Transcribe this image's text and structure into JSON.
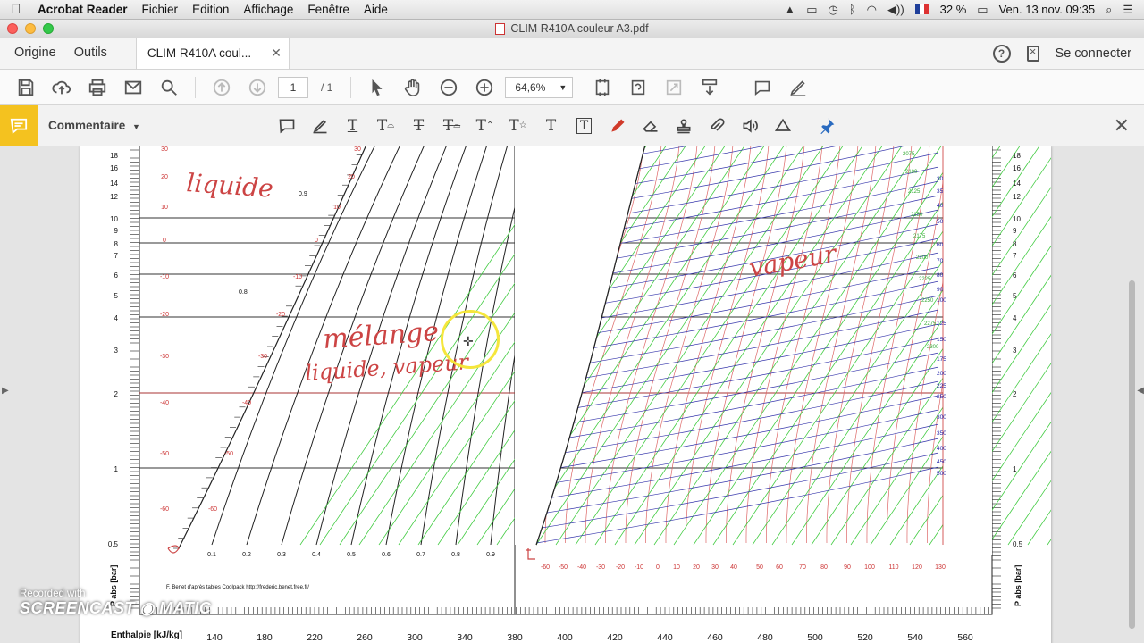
{
  "menubar": {
    "app_name": "Acrobat Reader",
    "menus": [
      "Fichier",
      "Edition",
      "Affichage",
      "Fenêtre",
      "Aide"
    ],
    "battery": "32 %",
    "datetime": "Ven. 13 nov.  09:35"
  },
  "window": {
    "title": "CLIM R410A couleur A3.pdf"
  },
  "tabs": {
    "home": "Origine",
    "tools": "Outils",
    "document": "CLIM R410A coul...",
    "sign_in": "Se connecter"
  },
  "toolbar": {
    "page_current": "1",
    "page_total": "/ 1",
    "zoom": "64,6%"
  },
  "comment_bar": {
    "label": "Commentaire"
  },
  "icons": {
    "save": "save-icon",
    "upload": "upload-icon",
    "print": "print-icon",
    "email": "email-icon",
    "search": "search-icon",
    "prev": "arrow-up-icon",
    "next": "arrow-down-icon",
    "select": "cursor-icon",
    "hand": "hand-icon",
    "zoom_out": "zoom-out-icon",
    "zoom_in": "zoom-in-icon"
  },
  "chart": {
    "pressure_ticks_left": [
      "18",
      "16",
      "14",
      "12",
      "10",
      "9",
      "8",
      "7",
      "6",
      "5",
      "4",
      "3",
      "2",
      "1",
      "0,5"
    ],
    "pressure_ticks_right": [
      "18",
      "16",
      "14",
      "12",
      "10",
      "9",
      "8",
      "7",
      "6",
      "5",
      "4",
      "3",
      "2",
      "1",
      "0,5"
    ],
    "enthalpy_ticks": [
      "140",
      "180",
      "220",
      "260",
      "300",
      "340",
      "380",
      "400",
      "420",
      "440",
      "460",
      "480",
      "500",
      "520",
      "540",
      "560"
    ],
    "enthalpy_axis_label": "Enthalpie [kJ/kg]",
    "pressure_axis_label": "P abs [bar]",
    "quality_labels": [
      "0.1",
      "0.2",
      "0.3",
      "0.4",
      "0.5",
      "0.6",
      "0.7",
      "0.8",
      "0.9"
    ],
    "quality_upper": [
      "0.9",
      "0.8"
    ],
    "temp_labels_left": [
      "30",
      "20",
      "10",
      "0",
      "-10",
      "-20",
      "-30",
      "-40",
      "-50",
      "-60"
    ],
    "temp_labels_mid": [
      "30",
      "20",
      "10",
      "0",
      "-10",
      "-20",
      "-30",
      "-40",
      "-50",
      "-60"
    ],
    "temp_labels_right": [
      "30",
      "20",
      "10",
      "0",
      "-10",
      "-20",
      "-30",
      "-40",
      "-50",
      "-60"
    ],
    "bottom_temps": [
      "-60",
      "-50",
      "-40",
      "-30",
      "-20",
      "-10",
      "0",
      "10",
      "20",
      "30",
      "40",
      "50",
      "60",
      "70",
      "80",
      "90",
      "100",
      "110",
      "120",
      "130"
    ],
    "superheat_labels": [
      "30",
      "35",
      "40",
      "50",
      "60",
      "70",
      "80",
      "90",
      "100",
      "125",
      "150",
      "175",
      "200",
      "225",
      "250",
      "300",
      "350",
      "400",
      "450",
      "500"
    ],
    "density_labels": [
      "2075",
      "2100",
      "2125",
      "2150",
      "2175",
      "2200",
      "2225",
      "2250",
      "2275",
      "2300"
    ],
    "credit": "F. Benet d'après tables Coolpack http://frederic.benet.free.fr/",
    "handwriting": {
      "liquid": "liquide",
      "mix": "mélange",
      "mix2": "liquide, vapeur",
      "vapor": "vapeur"
    }
  },
  "watermark": {
    "recorded": "Recorded with",
    "brand": "SCREENCAST ◉ MATIC"
  }
}
